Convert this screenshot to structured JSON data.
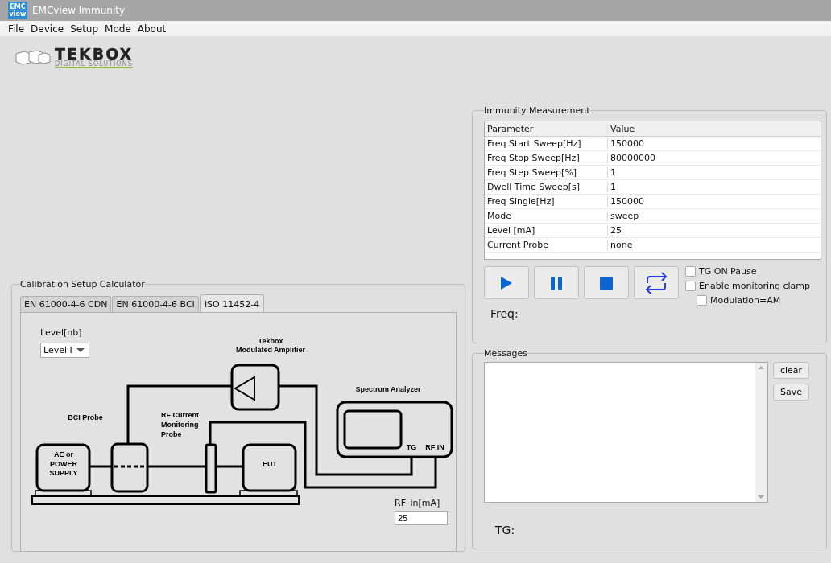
{
  "window": {
    "title": "EMCview Immunity",
    "app_icon_text": [
      "EMC",
      "view"
    ]
  },
  "menu": [
    "File",
    "Device",
    "Setup",
    "Mode",
    "About"
  ],
  "logo": {
    "name": "TEKBOX",
    "tagline": "DIGITAL SOLUTIONS"
  },
  "calibration": {
    "title": "Calibration Setup Calculator",
    "tabs": [
      {
        "label": "EN 61000-4-6 CDN",
        "selected": false
      },
      {
        "label": "EN 61000-4-6 BCI",
        "selected": false
      },
      {
        "label": "ISO 11452-4",
        "selected": true
      }
    ],
    "level_label": "Level[nb]",
    "level_value": "Level I",
    "diagram_labels": [
      "Tekbox",
      "Modulated Amplifier",
      "Spectrum Analyzer",
      "BCI Probe",
      "RF Current",
      "Monitoring",
      "Probe",
      "AE or",
      "POWER",
      "SUPPLY",
      "EUT",
      "TG",
      "RF IN"
    ],
    "rf_in_label": "RF_in[mA]",
    "rf_in_value": "25"
  },
  "immunity": {
    "title": "Immunity Measurement",
    "columns": [
      "Parameter",
      "Value"
    ],
    "rows": [
      [
        "Freq Start Sweep[Hz]",
        "150000"
      ],
      [
        "Freq Stop Sweep[Hz]",
        "80000000"
      ],
      [
        "Freq Step Sweep[%]",
        "1"
      ],
      [
        "Dwell Time Sweep[s]",
        "1"
      ],
      [
        "Freq Single[Hz]",
        "150000"
      ],
      [
        "Mode",
        "sweep"
      ],
      [
        "Level [mA]",
        "25"
      ],
      [
        "Current Probe",
        "none"
      ]
    ],
    "buttons": [
      {
        "kind": "play"
      },
      {
        "kind": "pause"
      },
      {
        "kind": "stop"
      },
      {
        "kind": "repeat"
      }
    ],
    "checkboxes": [
      {
        "label": "TG ON Pause",
        "checked": false
      },
      {
        "label": "Enable monitoring clamp",
        "checked": false
      },
      {
        "label": "Modulation=AM",
        "checked": false
      }
    ],
    "freq_label": "Freq:"
  },
  "messages": {
    "title": "Messages",
    "buttons": [
      "clear",
      "Save"
    ],
    "tg_label": "TG:"
  }
}
